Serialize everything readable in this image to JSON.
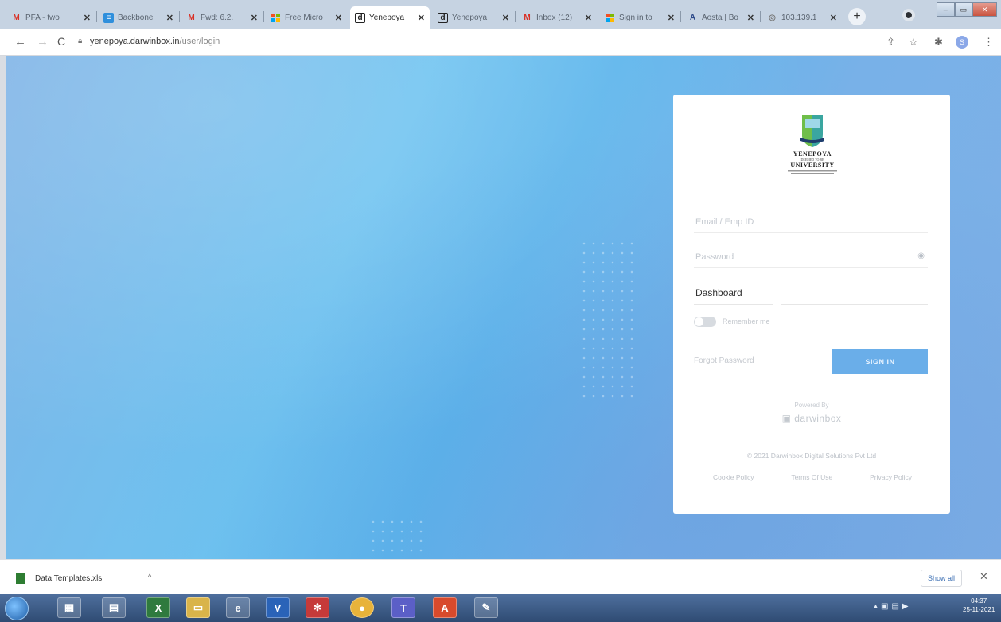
{
  "browser": {
    "tabs": [
      {
        "title": "PFA - two",
        "icon": "gmail-icon",
        "active": false
      },
      {
        "title": "Backbone",
        "icon": "sheets-icon",
        "active": false
      },
      {
        "title": "Fwd: 6.2.",
        "icon": "gmail-icon",
        "active": false
      },
      {
        "title": "Free Micro",
        "icon": "microsoft-icon",
        "active": false
      },
      {
        "title": "Yenepoya",
        "icon": "darwinbox-icon",
        "active": true
      },
      {
        "title": "Yenepoya",
        "icon": "darwinbox-icon",
        "active": false
      },
      {
        "title": "Inbox (12)",
        "icon": "gmail-icon",
        "active": false
      },
      {
        "title": "Sign in to",
        "icon": "microsoft-icon",
        "active": false
      },
      {
        "title": "Aosta | Bo",
        "icon": "aosta-icon",
        "active": false
      },
      {
        "title": "103.139.1",
        "icon": "globe-icon",
        "active": false
      }
    ],
    "url_host": "yenepoya.darwinbox.in",
    "url_path": "/user/login",
    "avatar_letter": "S"
  },
  "login": {
    "logo_name": "YENEPOYA",
    "logo_subtitle": "DEEMED TO BE",
    "logo_university": "UNIVERSITY",
    "email_placeholder": "Email / Emp ID",
    "password_placeholder": "Password",
    "dashboard_value": "Dashboard",
    "remember_label": "Remember me",
    "remember_on": false,
    "forgot_label": "Forgot Password",
    "signin_label": "SIGN IN",
    "powered_by": "Powered By",
    "brand": "darwinbox",
    "copyright": "© 2021 Darwinbox Digital Solutions Pvt Ltd",
    "links": [
      "Cookie Policy",
      "Terms Of Use",
      "Privacy Policy"
    ]
  },
  "downloads": {
    "file_name": "Data Templates.xls",
    "show_all": "Show all"
  },
  "taskbar": {
    "time": "04:37",
    "date": "25-11-2021"
  },
  "colors": {
    "accent": "#6aaee9",
    "background_blue": "#6fc3f0",
    "taskbar": "#3b5a86"
  }
}
